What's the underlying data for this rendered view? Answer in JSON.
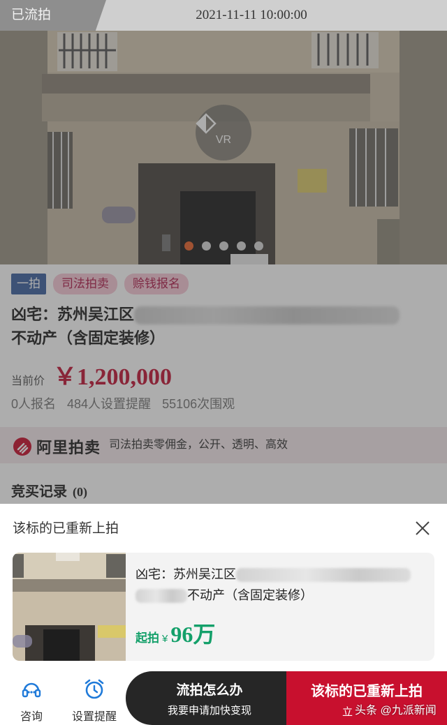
{
  "header": {
    "status": "已流拍",
    "auction_time": "2021-11-11 10:00:00"
  },
  "gallery": {
    "vr_label": "VR",
    "slide_count": 5,
    "active_slide": 1
  },
  "listing": {
    "tags": [
      "一拍",
      "司法拍卖",
      "赊钱报名"
    ],
    "title_prefix": "凶宅：苏州吴江区",
    "title_suffix": "不动产（含固定装修）",
    "price_label": "当前价",
    "price": "￥1,200,000",
    "stats": [
      "0人报名",
      "484人设置提醒",
      "55106次围观"
    ]
  },
  "ali": {
    "brand": "阿里拍卖",
    "slogan": "司法拍卖零佣金，公开、透明、高效"
  },
  "records": {
    "label": "竞买记录",
    "count": "(0)"
  },
  "sheet": {
    "title": "该标的已重新上拍",
    "card_title_prefix": "凶宅：苏州吴江区",
    "card_title_suffix": "不动产（含固定装修）",
    "start_label": "起拍",
    "currency": "¥",
    "start_price": "96万"
  },
  "actions": {
    "consult": "咨询",
    "remind": "设置提醒",
    "what_now_main": "流拍怎么办",
    "what_now_sub": "我要申请加快变现",
    "relisted_main": "该标的已重新上拍",
    "relisted_sub": "立"
  },
  "watermark": "头条 @九派新闻",
  "colors": {
    "price_red": "#c21536",
    "green": "#14a06a",
    "tag_blue": "#3e63a0",
    "action_red": "#c8102e"
  }
}
